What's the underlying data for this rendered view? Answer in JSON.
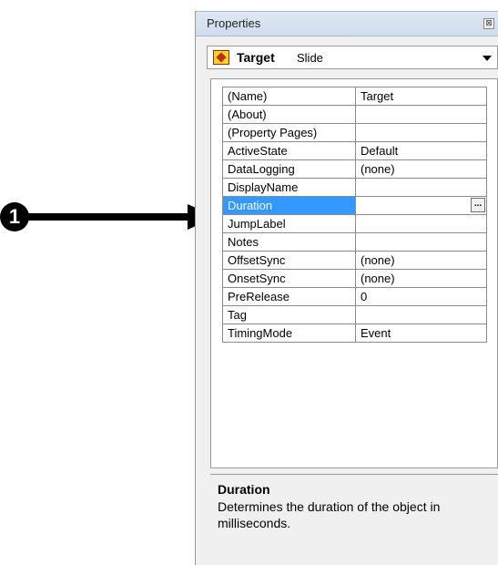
{
  "callout": {
    "number": "1"
  },
  "panel": {
    "title": "Properties",
    "close_glyph": "⊠"
  },
  "object_selector": {
    "name": "Target",
    "type": "Slide"
  },
  "properties": [
    {
      "name": "(Name)",
      "value": "Target"
    },
    {
      "name": "(About)",
      "value": ""
    },
    {
      "name": "(Property Pages)",
      "value": ""
    },
    {
      "name": "ActiveState",
      "value": "Default"
    },
    {
      "name": "DataLogging",
      "value": "(none)"
    },
    {
      "name": "DisplayName",
      "value": ""
    },
    {
      "name": "Duration",
      "value": "",
      "selected": true,
      "button": "..."
    },
    {
      "name": "JumpLabel",
      "value": ""
    },
    {
      "name": "Notes",
      "value": ""
    },
    {
      "name": "OffsetSync",
      "value": "(none)"
    },
    {
      "name": "OnsetSync",
      "value": "(none)"
    },
    {
      "name": "PreRelease",
      "value": "0"
    },
    {
      "name": "Tag",
      "value": ""
    },
    {
      "name": "TimingMode",
      "value": "Event"
    }
  ],
  "description": {
    "title": "Duration",
    "text": "Determines the duration of the object in milliseconds."
  }
}
